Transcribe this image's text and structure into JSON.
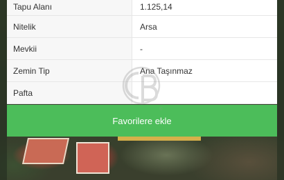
{
  "details": {
    "rows": [
      {
        "label": "Tapu Alanı",
        "value": "1.125,14"
      },
      {
        "label": "Nitelik",
        "value": "Arsa"
      },
      {
        "label": "Mevkii",
        "value": "-"
      },
      {
        "label": "Zemin Tip",
        "value": "Ana Taşınmaz"
      },
      {
        "label": "Pafta",
        "value": ""
      }
    ]
  },
  "actions": {
    "favorite_label": "Favorilere ekle"
  },
  "watermark": {
    "icon": "cb-logo-watermark"
  },
  "colors": {
    "favorite_button": "#4cbd5a",
    "label_background": "#f7f7f7",
    "divider": "#e6e6e6"
  }
}
